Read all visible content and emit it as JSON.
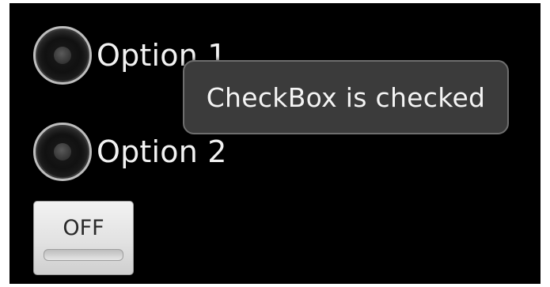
{
  "radio_group": {
    "options": [
      {
        "label": "Option 1",
        "checked": false
      },
      {
        "label": "Option 2",
        "checked": false
      }
    ]
  },
  "toast": {
    "message": "CheckBox is checked"
  },
  "toggle_button": {
    "label": "OFF",
    "state": "off"
  }
}
